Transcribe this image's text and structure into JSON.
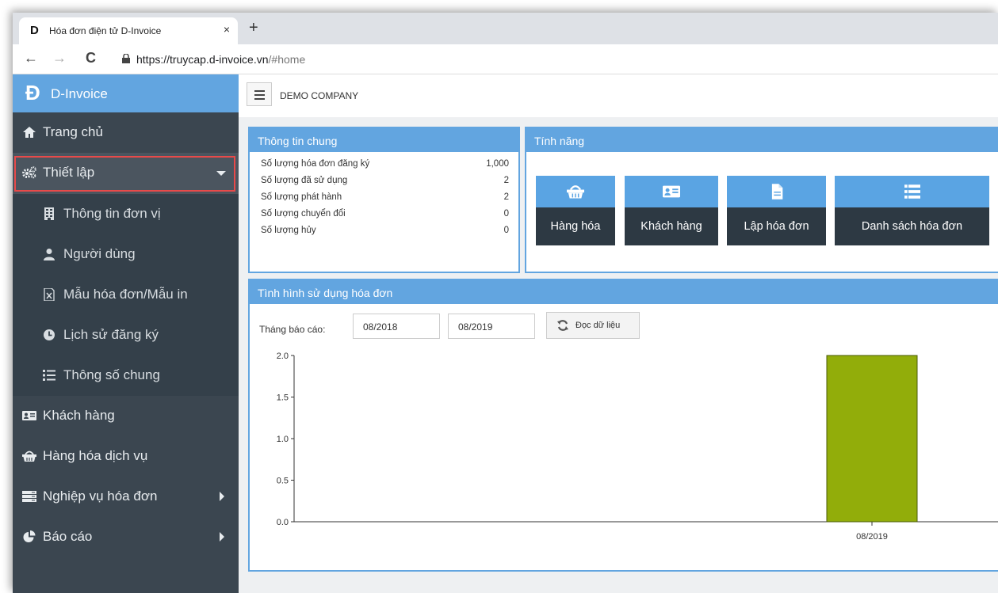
{
  "browser": {
    "tab_title": "Hóa đơn điện tử D-Invoice",
    "tab_favicon": "D",
    "close": "×",
    "new_tab": "+",
    "url_host": "https://truycap.d-invoice.vn",
    "url_path": "/#home",
    "back": "←",
    "forward": "→",
    "reload": "C"
  },
  "sidebar": {
    "brand_logo": "Ɖ",
    "brand_name": "D-Invoice",
    "items": [
      {
        "label": "Trang chủ",
        "icon": "home-icon"
      },
      {
        "label": "Thiết lập",
        "icon": "cogs-icon"
      },
      {
        "label": "Khách hàng",
        "icon": "contact-card-icon"
      },
      {
        "label": "Hàng hóa dịch vụ",
        "icon": "basket-icon"
      },
      {
        "label": "Nghiệp vụ hóa đơn",
        "icon": "server-icon"
      },
      {
        "label": "Báo cáo",
        "icon": "pie-chart-icon"
      }
    ],
    "submenu": [
      {
        "label": "Thông tin đơn vị",
        "icon": "building-icon"
      },
      {
        "label": "Người dùng",
        "icon": "user-icon"
      },
      {
        "label": "Mẫu hóa đơn/Mẫu in",
        "icon": "excel-file-icon"
      },
      {
        "label": "Lịch sử đăng ký",
        "icon": "clock-icon"
      },
      {
        "label": "Thông số chung",
        "icon": "list-icon"
      }
    ]
  },
  "header": {
    "company": "DEMO COMPANY"
  },
  "info_panel": {
    "title": "Thông tin chung",
    "rows": [
      {
        "label": "Số lượng hóa đơn đăng ký",
        "value": "1,000"
      },
      {
        "label": "Số lượng đã sử dụng",
        "value": "2"
      },
      {
        "label": "Số lượng phát hành",
        "value": "2"
      },
      {
        "label": "Số lượng chuyển đổi",
        "value": "0"
      },
      {
        "label": "Số lượng hủy",
        "value": "0"
      }
    ]
  },
  "features_panel": {
    "title": "Tính năng",
    "buttons": [
      {
        "label": "Hàng hóa",
        "icon": "basket-icon"
      },
      {
        "label": "Khách hàng",
        "icon": "contact-card-icon"
      },
      {
        "label": "Lập hóa đơn",
        "icon": "document-icon"
      },
      {
        "label": "Danh sách hóa đơn",
        "icon": "list-icon"
      }
    ]
  },
  "usage_panel": {
    "title": "Tình hình sử dụng hóa đơn",
    "month_label": "Tháng báo cáo:",
    "from_month": "08/2018",
    "to_month": "08/2019",
    "refresh_label": "Đọc dữ liệu"
  },
  "chart_data": {
    "type": "bar",
    "categories": [
      "08/2019"
    ],
    "values": [
      2
    ],
    "ylim": [
      0,
      2
    ],
    "yticks": [
      "0.0",
      "0.5",
      "1.0",
      "1.5",
      "2.0"
    ],
    "bar_color": "#92ad0a"
  }
}
